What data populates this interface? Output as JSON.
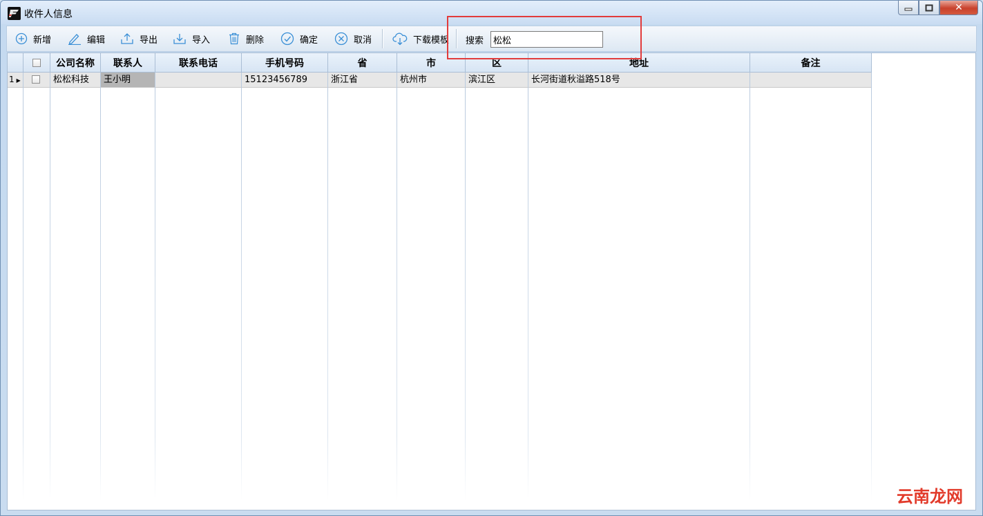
{
  "window": {
    "title": "收件人信息",
    "close_label": "✕"
  },
  "toolbar": {
    "buttons": [
      {
        "label": "新增",
        "icon": "add-circle-icon"
      },
      {
        "label": "编辑",
        "icon": "pencil-icon"
      },
      {
        "label": "导出",
        "icon": "export-upload-icon"
      },
      {
        "label": "导入",
        "icon": "import-download-icon"
      },
      {
        "label": "删除",
        "icon": "trash-icon"
      },
      {
        "label": "确定",
        "icon": "check-circle-icon"
      },
      {
        "label": "取消",
        "icon": "cancel-circle-icon"
      },
      {
        "label": "下载模板",
        "icon": "cloud-download-icon"
      }
    ],
    "search_label": "搜索",
    "search_value": "松松"
  },
  "grid": {
    "columns": [
      "公司名称",
      "联系人",
      "联系电话",
      "手机号码",
      "省",
      "市",
      "区",
      "地址",
      "备注"
    ],
    "rows": [
      {
        "index": "1",
        "company": "松松科技",
        "contact": "王小明",
        "phone": "",
        "mobile": "15123456789",
        "province": "浙江省",
        "city": "杭州市",
        "district": "滨江区",
        "address": "长河街道秋溢路518号",
        "note": ""
      }
    ]
  },
  "watermark": {
    "part1": "云南",
    "part2": "龙网"
  },
  "colors": {
    "accent_icon": "#3a8fd6",
    "highlight_box": "#e23b3b"
  }
}
